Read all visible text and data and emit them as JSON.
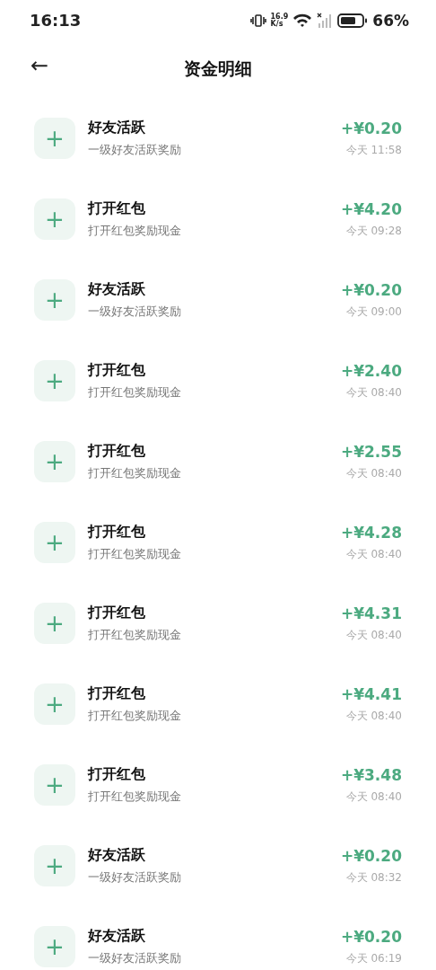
{
  "status_bar": {
    "time": "16:13",
    "net_speed": "16.9",
    "net_unit": "K/s",
    "battery": "66%"
  },
  "header": {
    "back": "←",
    "title": "资金明细"
  },
  "records": [
    {
      "icon": "+",
      "title": "好友活跃",
      "subtitle": "一级好友活跃奖励",
      "amount": "+¥0.20",
      "time": "今天 11:58"
    },
    {
      "icon": "+",
      "title": "打开红包",
      "subtitle": "打开红包奖励现金",
      "amount": "+¥4.20",
      "time": "今天 09:28"
    },
    {
      "icon": "+",
      "title": "好友活跃",
      "subtitle": "一级好友活跃奖励",
      "amount": "+¥0.20",
      "time": "今天 09:00"
    },
    {
      "icon": "+",
      "title": "打开红包",
      "subtitle": "打开红包奖励现金",
      "amount": "+¥2.40",
      "time": "今天 08:40"
    },
    {
      "icon": "+",
      "title": "打开红包",
      "subtitle": "打开红包奖励现金",
      "amount": "+¥2.55",
      "time": "今天 08:40"
    },
    {
      "icon": "+",
      "title": "打开红包",
      "subtitle": "打开红包奖励现金",
      "amount": "+¥4.28",
      "time": "今天 08:40"
    },
    {
      "icon": "+",
      "title": "打开红包",
      "subtitle": "打开红包奖励现金",
      "amount": "+¥4.31",
      "time": "今天 08:40"
    },
    {
      "icon": "+",
      "title": "打开红包",
      "subtitle": "打开红包奖励现金",
      "amount": "+¥4.41",
      "time": "今天 08:40"
    },
    {
      "icon": "+",
      "title": "打开红包",
      "subtitle": "打开红包奖励现金",
      "amount": "+¥3.48",
      "time": "今天 08:40"
    },
    {
      "icon": "+",
      "title": "好友活跃",
      "subtitle": "一级好友活跃奖励",
      "amount": "+¥0.20",
      "time": "今天 08:32"
    },
    {
      "icon": "+",
      "title": "好友活跃",
      "subtitle": "一级好友活跃奖励",
      "amount": "+¥0.20",
      "time": "今天 06:19"
    }
  ]
}
